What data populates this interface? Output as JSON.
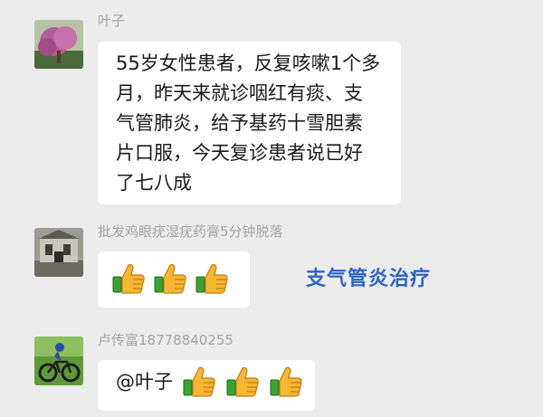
{
  "messages": [
    {
      "sender": "叶子",
      "avatar_icon": "flowering-tree-avatar",
      "text": "55岁女性患者，反复咳嗽1个多\n月，昨天来就诊咽红有痰、支\n气管肺炎，给予基药十雪胆素\n片口服，今天复诊患者说已好\n了七八成"
    },
    {
      "sender": "批发鸡眼疣湿疣药膏5分钟脱落",
      "avatar_icon": "building-photo-avatar",
      "emoji": [
        "thumbs-up",
        "thumbs-up",
        "thumbs-up"
      ]
    },
    {
      "sender": "卢传富18778840255",
      "avatar_icon": "cyclist-avatar",
      "mention": "@叶子",
      "emoji": [
        "thumbs-up",
        "thumbs-up",
        "thumbs-up"
      ]
    }
  ],
  "overlay_caption": "支气管炎治疗",
  "colors": {
    "background": "#ececec",
    "bubble": "#ffffff",
    "sender_name": "#a3a3a3",
    "caption": "#2b63c6"
  }
}
